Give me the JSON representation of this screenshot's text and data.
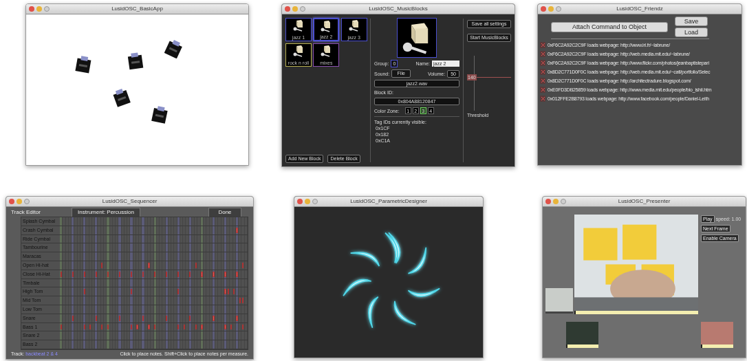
{
  "basic_app": {
    "title": "LusidOSC_BasicApp"
  },
  "music_blocks": {
    "title": "LusidOSC_MusicBlocks",
    "blocks": [
      {
        "label": "jazz 1",
        "selected": false,
        "color": "#4b4fd0"
      },
      {
        "label": "jazz 2",
        "selected": true,
        "color": "#4b4fd0"
      },
      {
        "label": "jazz 3",
        "selected": false,
        "color": "#4b4fd0"
      },
      {
        "label": "rock n roll",
        "selected": false,
        "color": "#b8b050"
      },
      {
        "label": "mixes",
        "selected": false,
        "color": "#8a4fb0"
      }
    ],
    "group_label": "Group:",
    "group_value": "0",
    "name_label": "Name:",
    "name_value": "jazz 2",
    "sound_label": "Sound:",
    "file_button": "File",
    "volume_label": "Volume:",
    "volume_value": "50",
    "sound_file": "jazz2.wav",
    "block_id_label": "Block ID:",
    "block_id": "0x804A88120847",
    "color_zone_label": "Color Zone:",
    "color_zones": [
      {
        "label": "1",
        "selected": false
      },
      {
        "label": "2",
        "selected": false
      },
      {
        "label": "3",
        "selected": true
      },
      {
        "label": "4",
        "selected": false
      }
    ],
    "visible_tags_heading": "Tag IDs currently visible:",
    "visible_tags": [
      "0x1CF",
      "0x182",
      "0xC1A"
    ],
    "save_button": "Save all settings",
    "start_button": "Start MusicBlocks",
    "threshold": {
      "value": "140",
      "label": "Threshold",
      "level": 0.6
    },
    "add_button": "Add New Block",
    "delete_button": "Delete Block"
  },
  "friendz": {
    "title": "LusidOSC_Friendz",
    "attach_button": "Attach Command to Object",
    "save_button": "Save",
    "load_button": "Load",
    "mappings": [
      "0xF6C2A92C2C9F loads webpage: http://www.iri.fr/~labrune/",
      "0xF6C2A92C2C9F loads webpage: http://web.media.mit.edu/~labrune/",
      "0xF6C2A92C2C9F loads webpage: http://www.flickr.com/photos/jeanbaptistepari",
      "0x8D2C771D0F0C loads webpage: http://web.media.mit.edu/~catl/portfolio/Selec",
      "0x8D2C771D0F0C loads webpage: http://architectradure.blogspot.com/",
      "0xE0FD3DB25859 loads webpage: http://www.media.mit.edu/people/bio_ishii.htm",
      "0x012FFE2B8793 loads webpage: http://www.facebook.com/people/Daniel-Leith"
    ]
  },
  "sequencer": {
    "title": "LusidOSC_Sequencer",
    "heading": "Track Editor",
    "instrument": "Instrument: Percussion",
    "done_button": "Done",
    "tracks": [
      {
        "name": "Splash Cymbal",
        "steps": [
          false,
          false,
          false,
          false,
          false,
          false,
          false,
          false,
          false,
          false,
          false,
          false,
          false,
          false,
          false,
          false,
          false,
          false,
          false,
          false,
          false,
          false,
          false,
          false,
          false,
          false,
          false,
          false,
          false,
          false,
          false,
          false,
          false,
          false,
          false,
          false,
          false,
          false,
          false,
          false,
          false,
          false,
          false,
          false,
          false,
          false,
          false,
          false,
          false,
          false,
          false,
          false,
          false,
          false,
          false,
          false,
          false,
          false,
          false,
          false,
          false,
          false,
          false,
          false
        ]
      },
      {
        "name": "Crash Cymbal",
        "steps": [
          false,
          false,
          false,
          false,
          false,
          false,
          false,
          false,
          false,
          false,
          false,
          false,
          false,
          false,
          false,
          false,
          false,
          false,
          false,
          false,
          false,
          false,
          false,
          false,
          false,
          false,
          false,
          false,
          false,
          false,
          false,
          false,
          false,
          false,
          false,
          false,
          false,
          false,
          false,
          false,
          false,
          false,
          false,
          false,
          false,
          false,
          false,
          false,
          false,
          false,
          false,
          false,
          false,
          false,
          false,
          false,
          false,
          false,
          false,
          false,
          true,
          false,
          false,
          false
        ]
      },
      {
        "name": "Ride Cymbal",
        "steps": [
          false,
          false,
          false,
          false,
          false,
          false,
          false,
          false,
          false,
          false,
          false,
          false,
          false,
          false,
          false,
          false,
          false,
          false,
          false,
          false,
          false,
          false,
          false,
          false,
          false,
          false,
          false,
          false,
          false,
          false,
          false,
          false,
          false,
          false,
          false,
          false,
          false,
          false,
          false,
          false,
          false,
          false,
          false,
          false,
          false,
          false,
          false,
          false,
          false,
          false,
          false,
          false,
          false,
          false,
          false,
          false,
          false,
          false,
          false,
          false,
          false,
          false,
          false,
          false
        ]
      },
      {
        "name": "Tambourine",
        "steps": [
          false,
          false,
          false,
          false,
          false,
          false,
          false,
          false,
          false,
          false,
          false,
          false,
          false,
          false,
          false,
          false,
          false,
          false,
          false,
          false,
          false,
          false,
          false,
          false,
          false,
          false,
          false,
          false,
          false,
          false,
          false,
          false,
          false,
          false,
          false,
          false,
          false,
          false,
          false,
          false,
          false,
          false,
          false,
          false,
          false,
          false,
          false,
          false,
          false,
          false,
          false,
          false,
          false,
          false,
          false,
          false,
          false,
          false,
          false,
          false,
          false,
          false,
          false,
          false
        ]
      },
      {
        "name": "Maracas",
        "steps": [
          false,
          false,
          false,
          false,
          false,
          false,
          false,
          false,
          false,
          false,
          false,
          false,
          false,
          false,
          false,
          false,
          false,
          false,
          false,
          false,
          false,
          false,
          false,
          false,
          false,
          false,
          false,
          false,
          false,
          false,
          false,
          false,
          false,
          false,
          false,
          false,
          false,
          false,
          false,
          false,
          false,
          false,
          false,
          false,
          false,
          false,
          false,
          false,
          false,
          false,
          false,
          false,
          false,
          false,
          false,
          false,
          false,
          false,
          false,
          false,
          false,
          false,
          false,
          false
        ]
      },
      {
        "name": "Open Hi-hat",
        "steps": [
          false,
          false,
          false,
          false,
          false,
          false,
          false,
          false,
          false,
          false,
          false,
          false,
          false,
          false,
          true,
          false,
          false,
          false,
          false,
          false,
          false,
          false,
          false,
          false,
          false,
          false,
          false,
          false,
          false,
          false,
          true,
          false,
          false,
          false,
          false,
          false,
          false,
          false,
          false,
          false,
          false,
          false,
          false,
          false,
          false,
          false,
          true,
          false,
          false,
          false,
          false,
          false,
          false,
          false,
          false,
          false,
          false,
          false,
          false,
          false,
          false,
          false,
          true,
          false
        ]
      },
      {
        "name": "Close Hi-Hat",
        "steps": [
          true,
          false,
          false,
          false,
          true,
          false,
          false,
          false,
          true,
          false,
          false,
          false,
          true,
          false,
          false,
          false,
          true,
          false,
          false,
          false,
          true,
          false,
          false,
          false,
          true,
          false,
          false,
          false,
          true,
          false,
          false,
          false,
          true,
          false,
          false,
          false,
          true,
          false,
          false,
          false,
          true,
          false,
          false,
          false,
          true,
          false,
          false,
          false,
          true,
          false,
          false,
          false,
          true,
          false,
          false,
          false,
          true,
          false,
          false,
          false,
          true,
          false,
          false,
          false
        ]
      },
      {
        "name": "Timbale",
        "steps": [
          false,
          false,
          false,
          false,
          false,
          false,
          false,
          false,
          false,
          false,
          false,
          false,
          false,
          false,
          false,
          false,
          false,
          false,
          false,
          false,
          false,
          false,
          false,
          false,
          false,
          false,
          false,
          false,
          false,
          false,
          false,
          false,
          false,
          false,
          false,
          false,
          false,
          false,
          false,
          false,
          false,
          false,
          false,
          false,
          false,
          false,
          false,
          false,
          false,
          false,
          false,
          false,
          false,
          false,
          false,
          false,
          false,
          false,
          false,
          false,
          false,
          false,
          false,
          false
        ]
      },
      {
        "name": "High Tom",
        "steps": [
          false,
          false,
          false,
          false,
          false,
          false,
          false,
          false,
          true,
          false,
          false,
          false,
          false,
          false,
          false,
          false,
          false,
          false,
          false,
          false,
          false,
          false,
          false,
          false,
          true,
          false,
          false,
          false,
          false,
          false,
          false,
          false,
          false,
          false,
          false,
          false,
          false,
          false,
          false,
          false,
          true,
          false,
          false,
          false,
          false,
          false,
          false,
          false,
          false,
          false,
          false,
          false,
          false,
          false,
          false,
          false,
          true,
          true,
          false,
          true,
          false,
          false,
          false,
          false
        ]
      },
      {
        "name": "Mid Tom",
        "steps": [
          false,
          false,
          false,
          false,
          false,
          false,
          false,
          false,
          false,
          false,
          false,
          false,
          false,
          false,
          false,
          false,
          false,
          false,
          false,
          false,
          false,
          false,
          false,
          false,
          false,
          false,
          false,
          false,
          false,
          false,
          false,
          false,
          false,
          false,
          false,
          false,
          false,
          false,
          false,
          false,
          false,
          false,
          false,
          false,
          false,
          false,
          false,
          false,
          false,
          false,
          false,
          false,
          false,
          false,
          false,
          false,
          false,
          false,
          false,
          false,
          false,
          true,
          true,
          false
        ]
      },
      {
        "name": "Low Tom",
        "steps": [
          false,
          false,
          false,
          false,
          false,
          false,
          false,
          false,
          false,
          false,
          false,
          false,
          false,
          false,
          false,
          false,
          false,
          false,
          false,
          false,
          false,
          false,
          false,
          false,
          false,
          false,
          false,
          false,
          false,
          false,
          false,
          false,
          false,
          false,
          false,
          false,
          false,
          false,
          false,
          false,
          false,
          false,
          false,
          false,
          false,
          false,
          false,
          false,
          false,
          false,
          false,
          false,
          false,
          false,
          false,
          false,
          false,
          false,
          false,
          false,
          false,
          false,
          false,
          false
        ]
      },
      {
        "name": "Snare",
        "steps": [
          false,
          false,
          false,
          false,
          true,
          false,
          false,
          false,
          false,
          false,
          false,
          false,
          true,
          false,
          false,
          false,
          false,
          false,
          false,
          false,
          true,
          false,
          false,
          false,
          false,
          false,
          false,
          false,
          true,
          false,
          false,
          false,
          false,
          false,
          false,
          false,
          true,
          false,
          false,
          false,
          false,
          false,
          false,
          false,
          true,
          false,
          false,
          false,
          false,
          false,
          false,
          false,
          true,
          false,
          false,
          false,
          false,
          false,
          false,
          false,
          true,
          false,
          false,
          false
        ]
      },
      {
        "name": "Bass 1",
        "steps": [
          true,
          false,
          false,
          false,
          false,
          false,
          false,
          false,
          true,
          false,
          true,
          false,
          false,
          false,
          true,
          false,
          true,
          false,
          false,
          false,
          false,
          false,
          false,
          false,
          true,
          false,
          true,
          false,
          false,
          false,
          true,
          false,
          true,
          false,
          false,
          false,
          false,
          false,
          false,
          false,
          true,
          false,
          true,
          false,
          false,
          false,
          true,
          false,
          true,
          false,
          false,
          false,
          false,
          false,
          false,
          false,
          true,
          false,
          true,
          false,
          false,
          false,
          true,
          false
        ]
      },
      {
        "name": "Snare 2",
        "steps": [
          false,
          false,
          false,
          false,
          false,
          false,
          false,
          false,
          false,
          false,
          false,
          false,
          false,
          false,
          false,
          false,
          false,
          false,
          false,
          false,
          false,
          false,
          false,
          false,
          false,
          false,
          false,
          false,
          false,
          false,
          false,
          false,
          false,
          false,
          false,
          false,
          false,
          false,
          false,
          false,
          false,
          false,
          false,
          false,
          false,
          false,
          false,
          false,
          false,
          false,
          false,
          false,
          false,
          false,
          false,
          false,
          false,
          false,
          false,
          false,
          false,
          false,
          false,
          false
        ]
      },
      {
        "name": "Bass 2",
        "steps": [
          false,
          false,
          false,
          false,
          false,
          false,
          false,
          false,
          false,
          false,
          false,
          false,
          false,
          false,
          false,
          false,
          false,
          false,
          false,
          false,
          false,
          false,
          false,
          false,
          false,
          false,
          false,
          false,
          false,
          false,
          false,
          false,
          false,
          false,
          false,
          false,
          false,
          false,
          false,
          false,
          false,
          false,
          false,
          false,
          false,
          false,
          false,
          false,
          false,
          false,
          false,
          false,
          false,
          false,
          false,
          false,
          false,
          false,
          false,
          false,
          false,
          false,
          false,
          false
        ]
      }
    ],
    "track_label": "Track:",
    "track_name": "backbeat 2 & 4",
    "hint": "Click to place notes.  Shift+Click to place notes per measure."
  },
  "parametric": {
    "title": "LusidOSC_ParametricDesigner"
  },
  "presenter": {
    "title": "LusidOSC_Presenter",
    "play_button": "Play",
    "speed": "speed: 1.00",
    "next_frame_button": "Next Frame",
    "enable_camera_button": "Enable Camera"
  }
}
